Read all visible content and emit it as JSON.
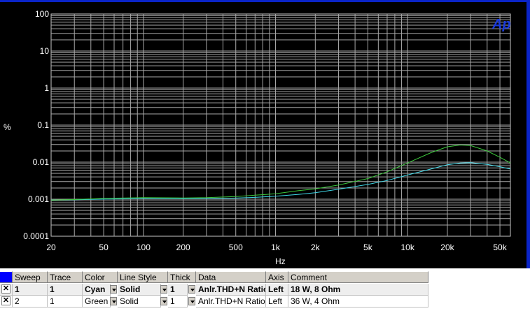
{
  "chart_data": {
    "type": "line",
    "title": "",
    "xlabel": "Hz",
    "ylabel": "%",
    "x_scale": "log",
    "y_scale": "log",
    "xlim": [
      20,
      60000
    ],
    "ylim": [
      0.0001,
      100
    ],
    "grid": true,
    "x_tick_labels": [
      "20",
      "50",
      "100",
      "200",
      "500",
      "1k",
      "2k",
      "5k",
      "10k",
      "20k",
      "50k"
    ],
    "x_tick_values": [
      20,
      50,
      100,
      200,
      500,
      1000,
      2000,
      5000,
      10000,
      20000,
      50000
    ],
    "y_tick_labels": [
      "100",
      "10",
      "1",
      "0.1",
      "0.01",
      "0.001",
      "0.0001"
    ],
    "y_tick_values": [
      100,
      10,
      1,
      0.1,
      0.01,
      0.001,
      0.0001
    ],
    "series": [
      {
        "name": "18 W, 8 Ohm",
        "color": "#40d8e8",
        "x": [
          20,
          30,
          50,
          100,
          200,
          300,
          500,
          700,
          1000,
          1500,
          2000,
          3000,
          5000,
          7000,
          10000,
          15000,
          20000,
          25000,
          30000,
          40000,
          50000,
          60000
        ],
        "y": [
          0.00095,
          0.00097,
          0.001,
          0.00103,
          0.00102,
          0.00103,
          0.00107,
          0.00112,
          0.0012,
          0.00135,
          0.0015,
          0.00185,
          0.0025,
          0.0032,
          0.0045,
          0.0065,
          0.0085,
          0.0095,
          0.0097,
          0.0087,
          0.0075,
          0.0065
        ]
      },
      {
        "name": "36 W, 4 Ohm",
        "color": "#3cc83c",
        "x": [
          20,
          30,
          50,
          100,
          200,
          300,
          500,
          700,
          1000,
          1500,
          2000,
          3000,
          5000,
          7000,
          10000,
          15000,
          20000,
          25000,
          30000,
          40000,
          50000,
          60000
        ],
        "y": [
          0.00095,
          0.00098,
          0.00105,
          0.0011,
          0.00108,
          0.0011,
          0.00118,
          0.00128,
          0.0014,
          0.0017,
          0.0019,
          0.0024,
          0.0036,
          0.0055,
          0.0095,
          0.018,
          0.026,
          0.029,
          0.028,
          0.02,
          0.0135,
          0.0095
        ]
      }
    ]
  },
  "graph": {
    "logo": "Ap"
  },
  "legend": {
    "headers": [
      "Sweep",
      "Trace",
      "Color",
      "Line Style",
      "Thick",
      "Data",
      "Axis",
      "Comment"
    ],
    "rows": [
      {
        "sweep": "1",
        "trace": "1",
        "color": "Cyan",
        "style": "Solid",
        "thick": "1",
        "data": "Anlr.THD+N Ratio",
        "axis": "Left",
        "comment": "18 W, 8 Ohm"
      },
      {
        "sweep": "2",
        "trace": "1",
        "color": "Green",
        "style": "Solid",
        "thick": "1",
        "data": "Anlr.THD+N Ratio",
        "axis": "Left",
        "comment": "36 W, 4 Ohm"
      }
    ]
  }
}
